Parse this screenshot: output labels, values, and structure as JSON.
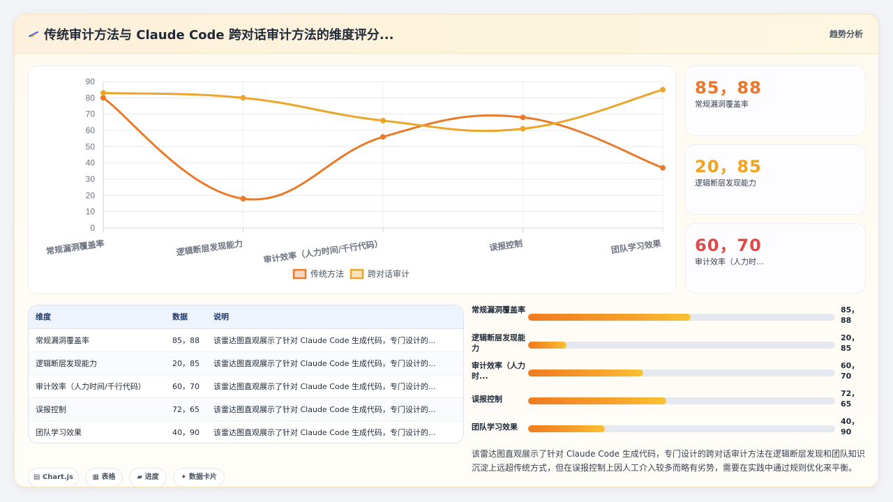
{
  "header": {
    "title": "传统审计方法与 Claude Code 跨对话审计方法的维度评分...",
    "tag": "趋势分析"
  },
  "chart_data": {
    "type": "line",
    "categories": [
      "常规漏洞覆盖率",
      "逻辑断层发现能力",
      "审计效率（人力时间/千行代码）",
      "误报控制",
      "团队学习效果"
    ],
    "series": [
      {
        "name": "传统方法",
        "values": [
          80,
          18,
          56,
          68,
          37
        ],
        "color": "#ea7a28"
      },
      {
        "name": "跨对话审计",
        "values": [
          83,
          80,
          66,
          61,
          85
        ],
        "color": "#eca528"
      }
    ],
    "yticks": [
      0,
      10,
      20,
      30,
      40,
      50,
      60,
      70,
      80,
      90
    ],
    "ylim": [
      0,
      90
    ]
  },
  "kpis": [
    {
      "value": "85，88",
      "label": "常规漏洞覆盖率",
      "color": "#ee7526"
    },
    {
      "value": "20，85",
      "label": "逻辑断层发现能力",
      "color": "#f0a320"
    },
    {
      "value": "60，70",
      "label": "审计效率（人力时...",
      "color": "#e04848"
    }
  ],
  "table": {
    "headers": [
      "维度",
      "数据",
      "说明"
    ],
    "rows": [
      [
        "常规漏洞覆盖率",
        "85，88",
        "该雷达图直观展示了针对 Claude Code 生成代码，专门设计的..."
      ],
      [
        "逻辑断层发现能力",
        "20，85",
        "该雷达图直观展示了针对 Claude Code 生成代码，专门设计的..."
      ],
      [
        "审计效率（人力时间/千行代码）",
        "60，70",
        "该雷达图直观展示了针对 Claude Code 生成代码，专门设计的..."
      ],
      [
        "误报控制",
        "72，65",
        "该雷达图直观展示了针对 Claude Code 生成代码，专门设计的..."
      ],
      [
        "团队学习效果",
        "40，90",
        "该雷达图直观展示了针对 Claude Code 生成代码，专门设计的..."
      ]
    ]
  },
  "progress": [
    {
      "label": "常规漏洞覆盖率",
      "value": "85，88",
      "fill": 0.53
    },
    {
      "label": "逻辑断层发现能力",
      "value": "20，85",
      "fill": 0.125
    },
    {
      "label": "审计效率（人力时...",
      "value": "60，70",
      "fill": 0.375
    },
    {
      "label": "误报控制",
      "value": "72，65",
      "fill": 0.45
    },
    {
      "label": "团队学习效果",
      "value": "40，90",
      "fill": 0.25
    }
  ],
  "summary": "该雷达图直观展示了针对 Claude Code 生成代码，专门设计的跨对话审计方法在逻辑断层发现和团队知识沉淀上远超传统方式，但在误报控制上因人工介入较多而略有劣势，需要在实践中通过规则优化来平衡。",
  "pills": [
    {
      "icon": "▤",
      "label": "Chart.js"
    },
    {
      "icon": "▦",
      "label": "表格"
    },
    {
      "icon": "▰",
      "label": "进度"
    },
    {
      "icon": "✦",
      "label": "数据卡片"
    }
  ]
}
